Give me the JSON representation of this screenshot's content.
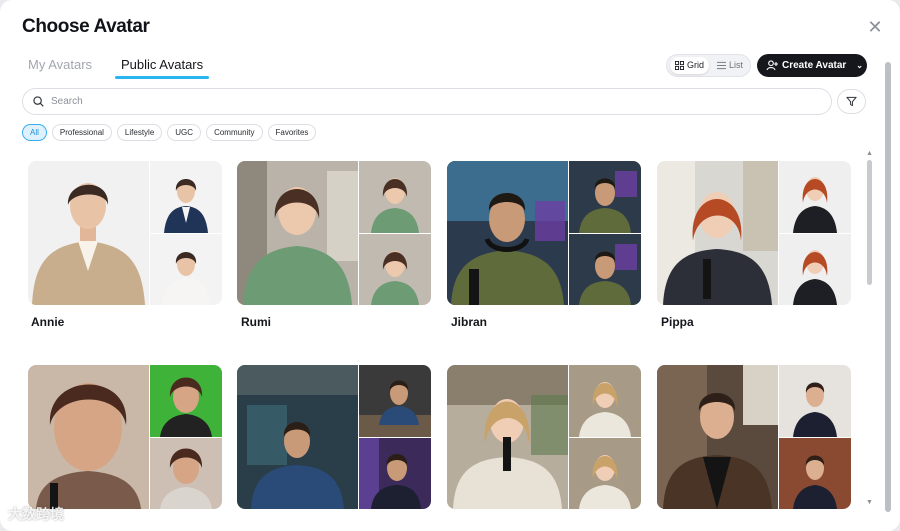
{
  "dialog": {
    "title": "Choose Avatar",
    "close_icon": "close-icon"
  },
  "tabs": [
    {
      "label": "My Avatars",
      "active": false
    },
    {
      "label": "Public Avatars",
      "active": true
    }
  ],
  "view_toggle": {
    "grid_label": "Grid",
    "list_label": "List",
    "selected": "Grid"
  },
  "create_button": {
    "label": "Create Avatar",
    "icon": "add-user-icon"
  },
  "search": {
    "placeholder": "Search",
    "value": ""
  },
  "filter_button": {
    "icon": "filter-icon"
  },
  "chips": [
    {
      "label": "All",
      "active": true
    },
    {
      "label": "Professional",
      "active": false
    },
    {
      "label": "Lifestyle",
      "active": false
    },
    {
      "label": "UGC",
      "active": false
    },
    {
      "label": "Community",
      "active": false
    },
    {
      "label": "Favorites",
      "active": false
    }
  ],
  "avatars": [
    {
      "name": "Annie"
    },
    {
      "name": "Rumi"
    },
    {
      "name": "Jibran"
    },
    {
      "name": "Pippa"
    },
    {
      "name": ""
    },
    {
      "name": ""
    },
    {
      "name": ""
    },
    {
      "name": ""
    }
  ],
  "watermark": "大数跨境",
  "colors": {
    "accent": "#29b6f0",
    "primary_button": "#15171c",
    "chip_active_bg": "#dff1fc"
  }
}
